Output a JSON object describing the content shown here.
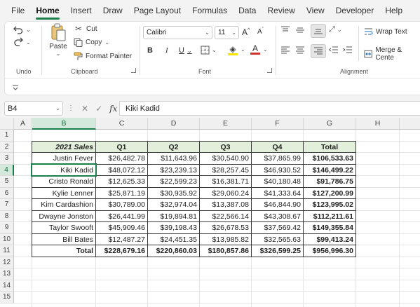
{
  "menu": [
    "File",
    "Home",
    "Insert",
    "Draw",
    "Page Layout",
    "Formulas",
    "Data",
    "Review",
    "View",
    "Developer",
    "Help"
  ],
  "ribbon": {
    "undo_label": "Undo",
    "clipboard": {
      "paste": "Paste",
      "cut": "Cut",
      "copy": "Copy",
      "format_painter": "Format Painter",
      "label": "Clipboard"
    },
    "font": {
      "name": "Calibri",
      "size": "11",
      "bold": "B",
      "italic": "I",
      "underline": "U",
      "grow": "A",
      "shrink": "A",
      "label": "Font"
    },
    "alignment": {
      "wrap_text": "Wrap Text",
      "merge_center": "Merge & Cente",
      "label": "Alignment"
    }
  },
  "formula_bar": {
    "name_box": "B4",
    "fx": "fx",
    "value": "Kiki Kadid"
  },
  "grid": {
    "columns": [
      "A",
      "B",
      "C",
      "D",
      "E",
      "F",
      "G",
      "H"
    ],
    "rows": [
      "1",
      "2",
      "3",
      "4",
      "5",
      "6",
      "7",
      "8",
      "9",
      "10",
      "11",
      "12",
      "13",
      "14",
      "15"
    ],
    "selected_column": "B",
    "selected_row": "4"
  },
  "table": {
    "headers": [
      "2021 Sales",
      "Q1",
      "Q2",
      "Q3",
      "Q4",
      "Total"
    ],
    "rows": [
      [
        "Justin Fever",
        "$26,482.78",
        "$11,643.96",
        "$30,540.90",
        "$37,865.99",
        "$106,533.63"
      ],
      [
        "Kiki Kadid",
        "$48,072.12",
        "$23,239.13",
        "$28,257.45",
        "$46,930.52",
        "$146,499.22"
      ],
      [
        "Cristo Ronald",
        "$12,625.33",
        "$22,599.23",
        "$16,381.71",
        "$40,180.48",
        "$91,786.75"
      ],
      [
        "Kylie Lenner",
        "$25,871.19",
        "$30,935.92",
        "$29,060.24",
        "$41,333.64",
        "$127,200.99"
      ],
      [
        "Kim Cardashion",
        "$30,789.00",
        "$32,974.04",
        "$13,387.08",
        "$46,844.90",
        "$123,995.02"
      ],
      [
        "Dwayne Jonston",
        "$26,441.99",
        "$19,894.81",
        "$22,566.14",
        "$43,308.67",
        "$112,211.61"
      ],
      [
        "Taylor Swooft",
        "$45,909.46",
        "$39,198.43",
        "$26,678.53",
        "$37,569.42",
        "$149,355.84"
      ],
      [
        "Bill Bates",
        "$12,487.27",
        "$24,451.35",
        "$13,985.82",
        "$32,565.63",
        "$99,413.24"
      ]
    ],
    "totals": [
      "Total",
      "$228,679.16",
      "$220,860.03",
      "$180,857.86",
      "$326,599.25",
      "$956,996.30"
    ]
  },
  "colors": {
    "accent": "#1a7f4b",
    "header_fill": "#e2efda",
    "selection_header": "#d3e9dc"
  }
}
